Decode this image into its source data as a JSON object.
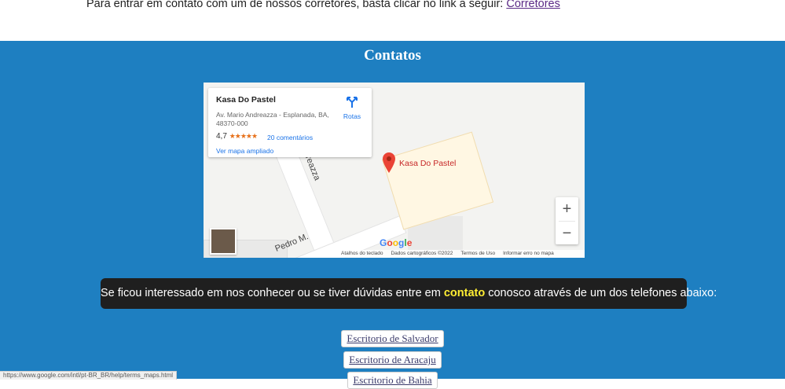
{
  "intro": {
    "text": "Para entrar em contato com um de nossos corretores, basta clicar no link a seguir:",
    "link": "Corretores"
  },
  "section": {
    "title": "Contatos"
  },
  "map": {
    "place_name": "Kasa Do Pastel",
    "address": "Av. Mario Andreazza - Esplanada, BA, 48370-000",
    "rating": "4,7",
    "stars": "★★★★★",
    "reviews": "20 comentários",
    "directions_label": "Rotas",
    "bigger_map": "Ver mapa ampliado",
    "pin_label": "Kasa Do Pastel",
    "road_label_1": "dreazza",
    "road_label_2": "Pedro M.",
    "zoom_in": "+",
    "zoom_out": "−",
    "logo": "Google",
    "attribution": [
      "Atalhos do teclado",
      "Dados cartográficos ©2022",
      "Termos de Uso",
      "Informar erro no mapa"
    ]
  },
  "banner": {
    "before": "Se ficou interessado em nos conhecer ou se tiver dúvidas entre em ",
    "highlight": "contato",
    "after": " conosco através de um dos telefones abaixo:"
  },
  "offices": [
    "Escritorio de Salvador",
    "Escritorio de Aracaju",
    "Escritorio de Bahia"
  ],
  "status_bar": {
    "url": "https://www.google.com/intl/pt-BR_BR/help/terms_maps.html"
  },
  "colors": {
    "section_bg": "#1e7fc1",
    "banner_bg": "#1f1f1f",
    "highlight": "#ffee33"
  }
}
